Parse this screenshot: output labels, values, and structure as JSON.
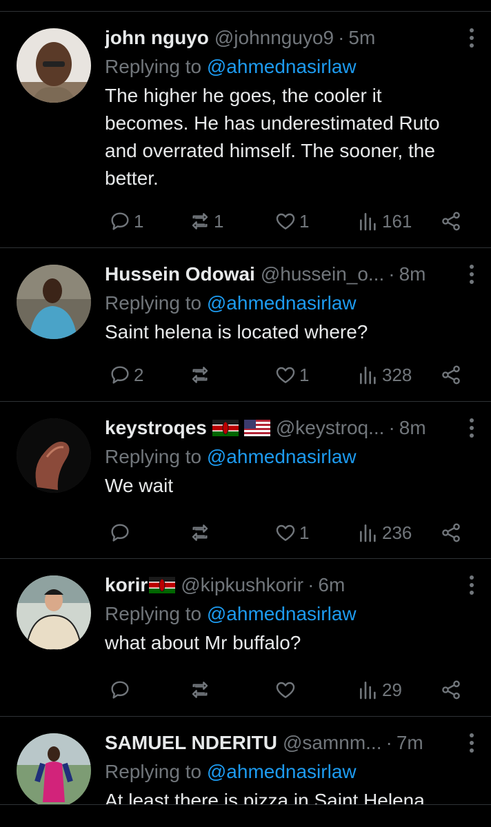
{
  "tweets": [
    {
      "name": "john nguyo",
      "flags": [],
      "handle": "@johnnguyo9",
      "time": "5m",
      "replying_prefix": "Replying to",
      "replying_to": "@ahmednasirlaw",
      "text_lines": [
        "The higher he goes, the cooler it",
        "becomes. He has underestimated Ruto",
        "and overrated himself. The sooner, the",
        "better."
      ],
      "stats": {
        "replies": "1",
        "retweets": "1",
        "likes": "1",
        "views": "161"
      }
    },
    {
      "name": "Hussein Odowai",
      "flags": [],
      "handle": "@hussein_o...",
      "time": "8m",
      "replying_prefix": "Replying to",
      "replying_to": "@ahmednasirlaw",
      "text_lines": [
        "Saint helena is located where?"
      ],
      "stats": {
        "replies": "2",
        "retweets": "",
        "likes": "1",
        "views": "328"
      }
    },
    {
      "name": "keystroqes",
      "flags": [
        "kenya",
        "usa"
      ],
      "handle": "@keystroq...",
      "time": "8m",
      "replying_prefix": "Replying to",
      "replying_to": "@ahmednasirlaw",
      "text_lines": [
        "We wait"
      ],
      "stats": {
        "replies": "",
        "retweets": "",
        "likes": "1",
        "views": "236"
      }
    },
    {
      "name": "korir",
      "flags": [
        "kenya"
      ],
      "handle": "@kipkushkorir",
      "time": "6m",
      "replying_prefix": "Replying to",
      "replying_to": "@ahmednasirlaw",
      "text_lines": [
        "what about Mr buffalo?"
      ],
      "stats": {
        "replies": "",
        "retweets": "",
        "likes": "",
        "views": "29"
      }
    },
    {
      "name": "SAMUEL NDERITU",
      "flags": [],
      "handle": "@samnm...",
      "time": "7m",
      "replying_prefix": "Replying to",
      "replying_to": "@ahmednasirlaw",
      "text_lines": [
        "At least there is pizza in Saint Helena"
      ],
      "stats": {
        "replies": "",
        "retweets": "",
        "likes": "",
        "views": ""
      }
    }
  ],
  "icons": {
    "reply": "reply-icon",
    "retweet": "retweet-icon",
    "like": "heart-icon",
    "views": "views-icon",
    "share": "share-icon",
    "more": "more-vertical-icon"
  },
  "colors": {
    "background": "#000000",
    "text": "#e7e9ea",
    "muted": "#71767b",
    "accent": "#1d9bf0",
    "divider": "#2f3336"
  }
}
